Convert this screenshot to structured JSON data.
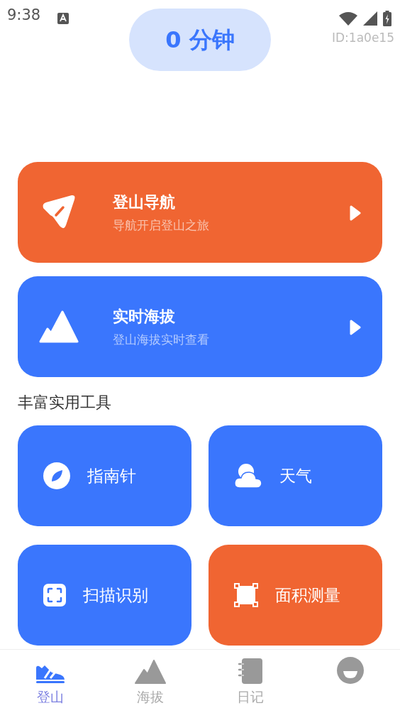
{
  "status_bar": {
    "time": "9:38"
  },
  "timer": {
    "text": "0 分钟"
  },
  "device_id": "ID:1a0e15",
  "feature_cards": [
    {
      "kind": "navigation",
      "title": "登山导航",
      "subtitle": "导航开启登山之旅",
      "color": "#f06532"
    },
    {
      "kind": "altitude",
      "title": "实时海拔",
      "subtitle": "登山海拔实时查看",
      "color": "#3a76fd"
    }
  ],
  "section_title": "丰富实用工具",
  "tools": [
    {
      "kind": "compass",
      "label": "指南针",
      "color": "#3a76fd"
    },
    {
      "kind": "weather",
      "label": "天气",
      "color": "#3a76fd"
    },
    {
      "kind": "scan",
      "label": "扫描识别",
      "color": "#3a76fd"
    },
    {
      "kind": "area",
      "label": "面积测量",
      "color": "#f06532"
    }
  ],
  "bottom_nav": [
    {
      "kind": "shoe",
      "label": "登山",
      "selected": true
    },
    {
      "kind": "mountain",
      "label": "海拔",
      "selected": false
    },
    {
      "kind": "notebook",
      "label": "日记",
      "selected": false
    },
    {
      "kind": "profile",
      "selected": false
    }
  ]
}
